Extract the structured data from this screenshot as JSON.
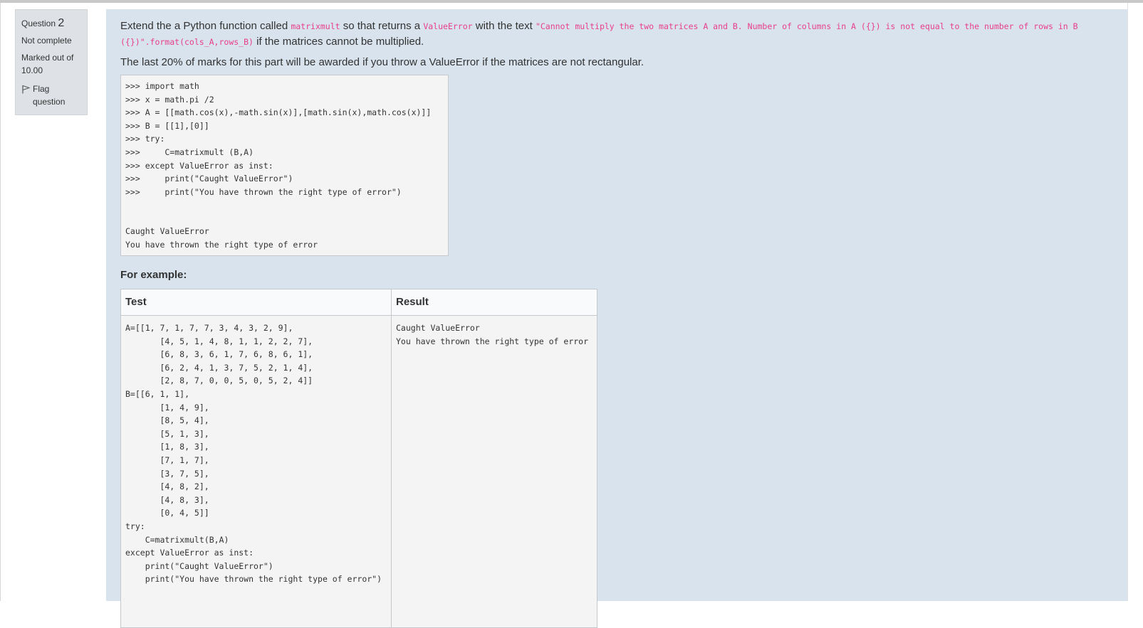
{
  "question": {
    "label": "Question",
    "number": "2",
    "status": "Not complete",
    "marked_out_of": "Marked out of 10.00",
    "flag_label": "Flag question"
  },
  "prompt": {
    "p1_a": "Extend the a Python function called ",
    "p1_code1": "matrixmult",
    "p1_b": " so that returns a ",
    "p1_code2": "ValueError",
    "p1_c": " with the text ",
    "p1_code3": "\"Cannot multiply the two matrices A and B. Number of columns in A ({}) is not equal to the number of rows in B ({})\".format(cols_A,rows_B)",
    "p1_d": " if the matrices cannot be multiplied.",
    "p2": "The last 20% of marks for this part will be awarded if you throw a ValueError if the matrices are not rectangular."
  },
  "code_example": {
    "input": ">>> import math\n>>> x = math.pi /2\n>>> A = [[math.cos(x),-math.sin(x)],[math.sin(x),math.cos(x)]]\n>>> B = [[1],[0]]\n>>> try:\n>>>     C=matrixmult (B,A)\n>>> except ValueError as inst:\n>>>     print(\"Caught ValueError\")\n>>>     print(\"You have thrown the right type of error\")",
    "output": "Caught ValueError\nYou have thrown the right type of error"
  },
  "examples": {
    "heading": "For example:",
    "col_test": "Test",
    "col_result": "Result",
    "test_code": "A=[[1, 7, 1, 7, 7, 3, 4, 3, 2, 9],\n       [4, 5, 1, 4, 8, 1, 1, 2, 2, 7],\n       [6, 8, 3, 6, 1, 7, 6, 8, 6, 1],\n       [6, 2, 4, 1, 3, 7, 5, 2, 1, 4],\n       [2, 8, 7, 0, 0, 5, 0, 5, 2, 4]]\nB=[[6, 1, 1],\n       [1, 4, 9],\n       [8, 5, 4],\n       [5, 1, 3],\n       [1, 8, 3],\n       [7, 1, 7],\n       [3, 7, 5],\n       [4, 8, 2],\n       [4, 8, 3],\n       [0, 4, 5]]\ntry:\n    C=matrixmult(B,A)\nexcept ValueError as inst:\n    print(\"Caught ValueError\")\n    print(\"You have thrown the right type of error\")",
    "result": "Caught ValueError\nYou have thrown the right type of error"
  },
  "colors": {
    "content_bg": "#d8e3ed",
    "info_bg": "#dee2e6",
    "code_inline": "#e83e8c"
  }
}
